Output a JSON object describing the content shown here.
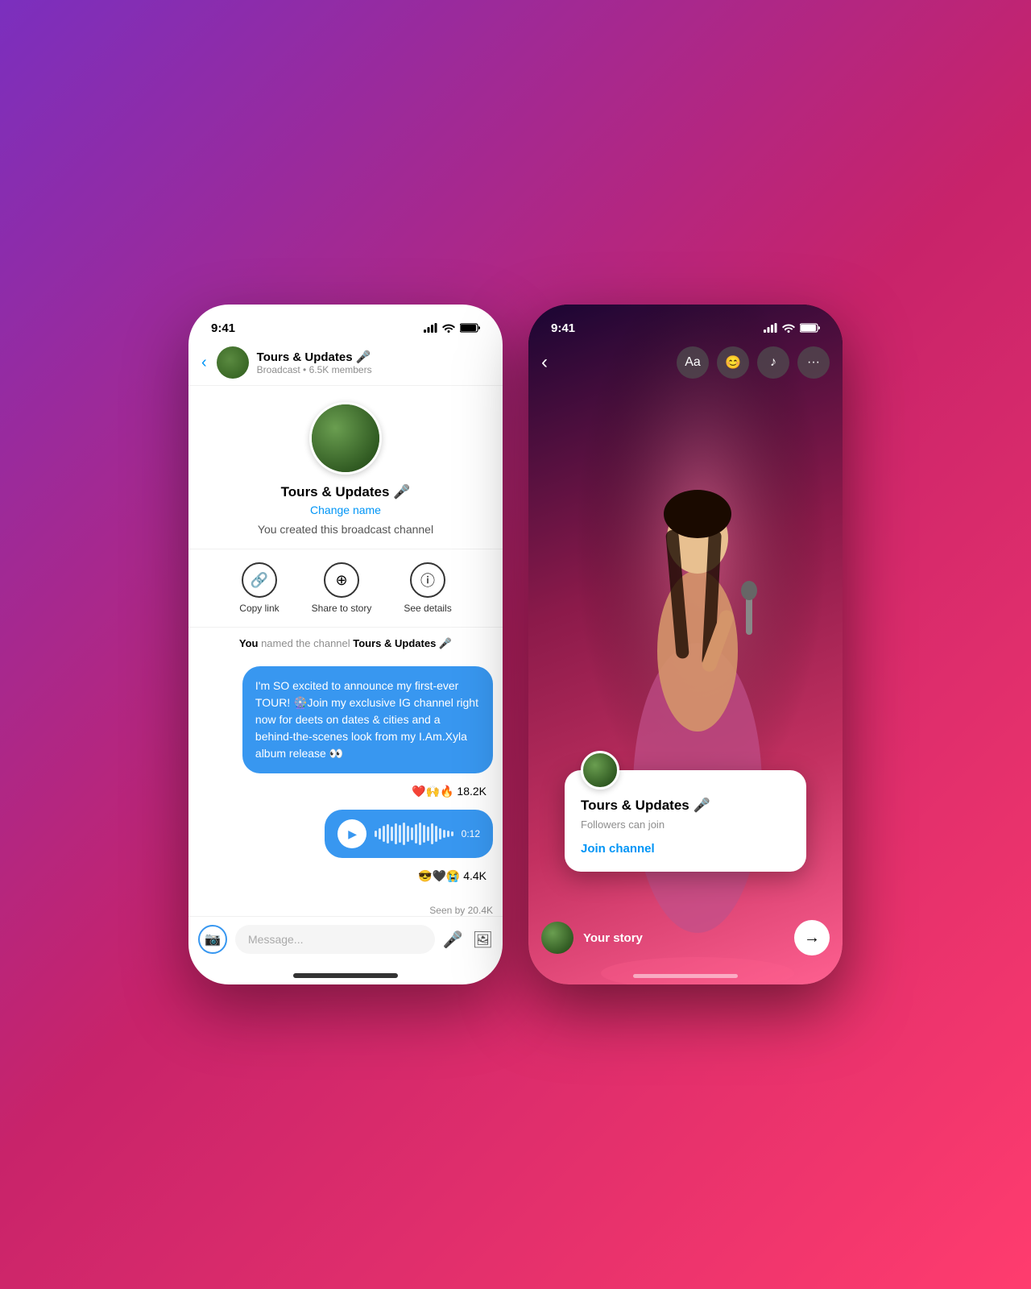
{
  "left_phone": {
    "status_time": "9:41",
    "header": {
      "channel_name": "Tours & Updates 🎤",
      "subtitle": "Broadcast • 6.5K members"
    },
    "profile": {
      "name": "Tours & Updates 🎤",
      "change_name_label": "Change name",
      "description": "You created this broadcast channel"
    },
    "actions": {
      "copy_link": "Copy link",
      "share_to_story": "Share to story",
      "see_details": "See details"
    },
    "system_message": "You named the channel Tours & Updates 🎤",
    "message1": {
      "text": "I'm SO excited to announce my first-ever TOUR! 🎡Join my exclusive IG channel right now for deets on dates & cities and a behind-the-scenes look from my I.Am.Xyla album release 👀",
      "reactions": "❤️🙌🔥 18.2K"
    },
    "voice_message": {
      "duration": "0:12",
      "reactions": "😎🖤😭 4.4K"
    },
    "seen_by": "Seen by 20.4K",
    "input_placeholder": "Message..."
  },
  "right_phone": {
    "status_time": "9:41",
    "tools": {
      "text": "Aa",
      "emoji": "😊",
      "music": "♪",
      "more": "•••"
    },
    "channel_card": {
      "name": "Tours & Updates 🎤",
      "subtitle": "Followers can join",
      "join_label": "Join channel"
    },
    "bottom": {
      "your_story": "Your story"
    }
  }
}
